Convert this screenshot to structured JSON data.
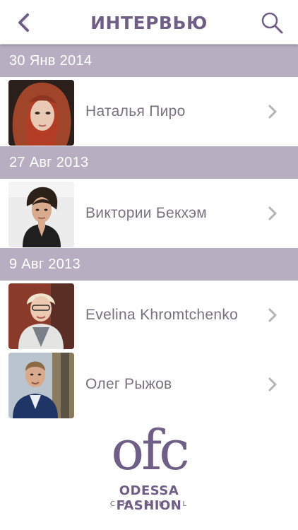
{
  "colors": {
    "accent": "#6f5f86",
    "section_bg": "#b8aec1",
    "text": "#77727d",
    "chevron": "#b7b3b9"
  },
  "header": {
    "title": "ИНТЕРВЬЮ",
    "back_icon": "chevron-left-icon",
    "search_icon": "search-icon"
  },
  "sections": [
    {
      "date": "30 Янв 2014",
      "items": [
        {
          "name": "Наталья Пиро"
        }
      ]
    },
    {
      "date": "27 Авг 2013",
      "items": [
        {
          "name": "Виктории Бекхэм"
        }
      ]
    },
    {
      "date": "9 Авг 2013",
      "items": [
        {
          "name": "Evelina Khromtchenko"
        },
        {
          "name": "Олег Рыжов"
        }
      ]
    }
  ],
  "logo": {
    "mark": "ofc",
    "line1": "ODESSA FASHION",
    "line2": "CHANNEL"
  }
}
